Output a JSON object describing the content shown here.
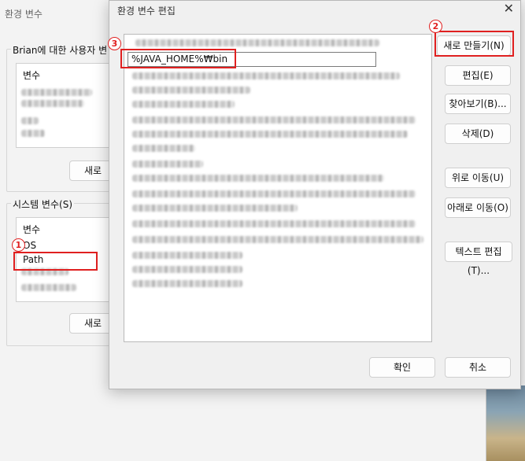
{
  "parent_window": {
    "title": "환경 변수",
    "user_section": {
      "label": "Brian에 대한 사용자 변",
      "column_header": "변수",
      "new_button": "새로"
    },
    "system_section": {
      "label": "시스템 변수(S)",
      "column_header": "변수",
      "rows": [
        "OS",
        "Path"
      ],
      "new_button": "새로"
    }
  },
  "dialog": {
    "title": "환경 변수 편집",
    "close_glyph": "✕",
    "editing_entry": "%JAVA_HOME%₩bin",
    "buttons": {
      "new": "새로 만들기(N)",
      "edit": "편집(E)",
      "browse": "찾아보기(B)...",
      "delete": "삭제(D)",
      "move_up": "위로 이동(U)",
      "move_down": "아래로 이동(O)",
      "edit_text": "텍스트 편집(T)...",
      "ok": "확인",
      "cancel": "취소"
    }
  },
  "annotations": {
    "step1": "1",
    "step2": "2",
    "step3": "3",
    "color": "#e02020"
  }
}
